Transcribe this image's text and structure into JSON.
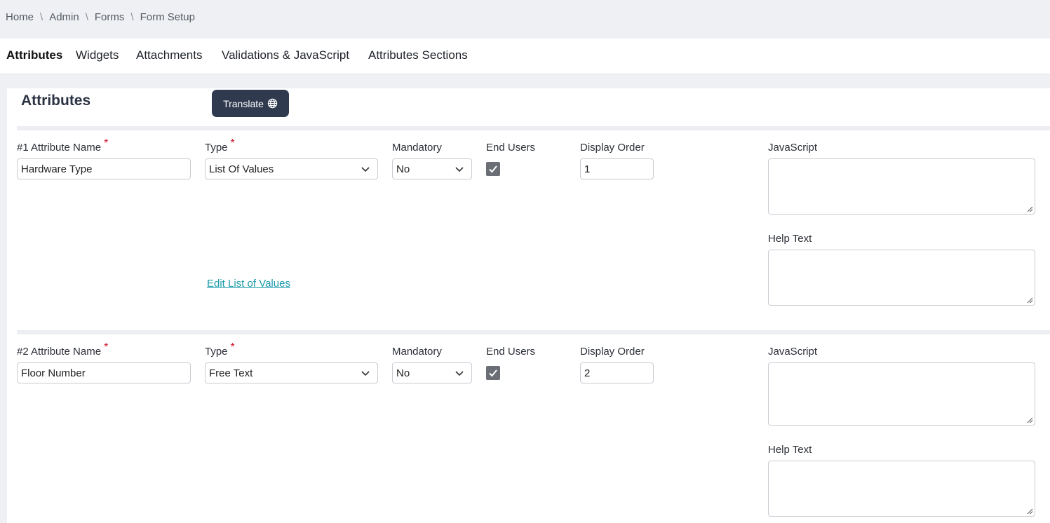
{
  "breadcrumb": [
    "Home",
    "Admin",
    "Forms",
    "Form Setup"
  ],
  "tabs": [
    "Attributes",
    "Widgets",
    "Attachments",
    "Validations & JavaScript",
    "Attributes Sections"
  ],
  "panel": {
    "title": "Attributes",
    "translate_label": "Translate"
  },
  "labels": {
    "type": "Type",
    "mandatory": "Mandatory",
    "end_users": "End Users",
    "display_order": "Display Order",
    "javascript": "JavaScript",
    "help_text": "Help Text",
    "required_mark": "*"
  },
  "attributes": [
    {
      "name_label": "#1 Attribute Name",
      "name_value": "Hardware Type",
      "type_value": "List Of Values",
      "mandatory_value": "No",
      "end_users_checked": true,
      "display_order": "1",
      "edit_link": "Edit List of Values"
    },
    {
      "name_label": "#2 Attribute Name",
      "name_value": "Floor Number",
      "type_value": "Free Text",
      "mandatory_value": "No",
      "end_users_checked": true,
      "display_order": "2"
    }
  ],
  "colors": {
    "primary_button": "#2f3a4f",
    "link": "#1a9ba8",
    "required": "#d0142c"
  },
  "icons": {
    "translate": "globe-icon",
    "dropdown": "chevron-down-icon",
    "check": "check-icon"
  }
}
